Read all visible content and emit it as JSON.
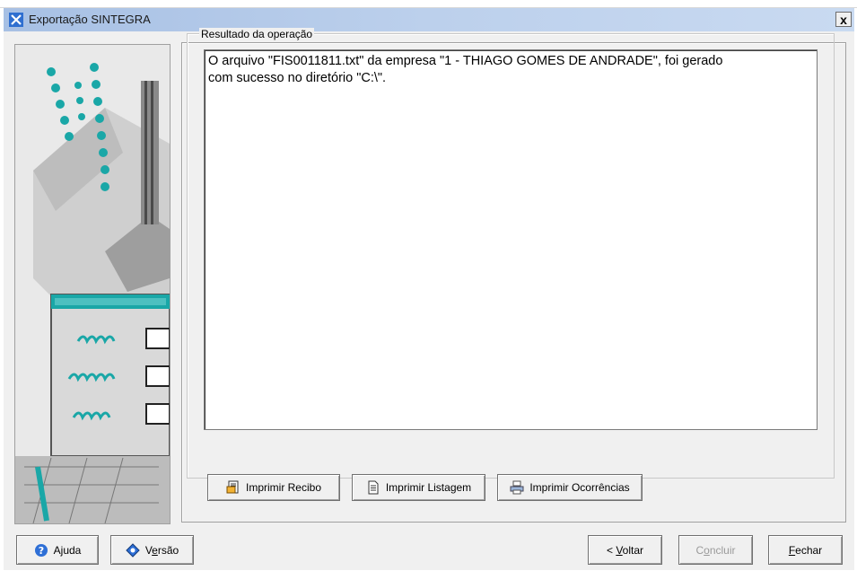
{
  "window": {
    "title": "Exportação SINTEGRA",
    "close_label": "x"
  },
  "group": {
    "label": "Resultado da operação"
  },
  "result": {
    "line1": "O arquivo \"FIS0011811.txt\" da empresa \"1 - THIAGO GOMES DE ANDRADE\", foi gerado",
    "line2": "com sucesso no diretório \"C:\\\"."
  },
  "print_buttons": [
    {
      "label": "Imprimir Recibo",
      "icon": "receipt-print-icon"
    },
    {
      "label": "Imprimir Listagem",
      "icon": "document-icon"
    },
    {
      "label": "Imprimir Ocorrências",
      "icon": "printer-icon"
    }
  ],
  "footer": {
    "help": {
      "pre": "A",
      "key": "j",
      "post": "uda",
      "icon": "help-icon"
    },
    "version": {
      "pre": "V",
      "key": "e",
      "post": "rsão",
      "icon": "diamond-icon"
    },
    "back": {
      "pre": "< ",
      "key": "V",
      "post": "oltar"
    },
    "finish": {
      "pre": "C",
      "key": "o",
      "post": "ncluir"
    },
    "close": {
      "pre": "",
      "key": "F",
      "post": "echar"
    }
  },
  "colors": {
    "titlebar": "#b3c9ea",
    "accent_teal": "#1aa7a7"
  }
}
